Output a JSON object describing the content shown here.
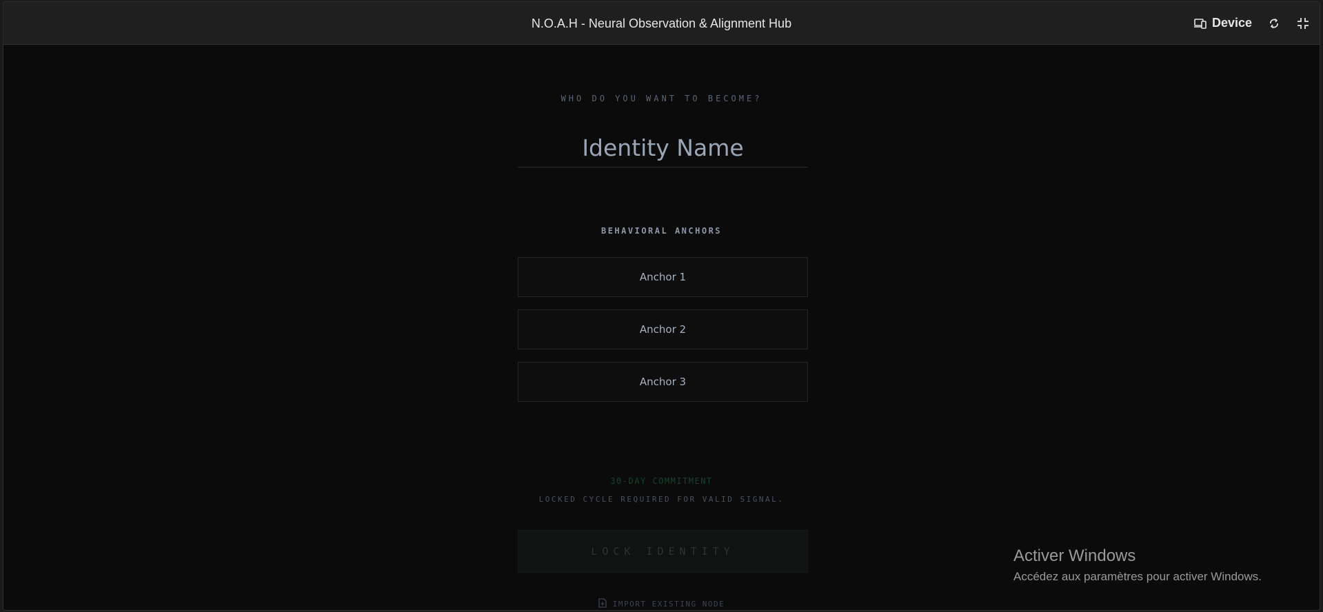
{
  "window": {
    "title": "N.O.A.H - Neural Observation & Alignment Hub",
    "device_label": "Device",
    "icons": [
      "device-icon",
      "sync-icon",
      "fullscreen-exit-icon"
    ]
  },
  "form": {
    "prompt": "WHO DO YOU WANT TO BECOME?",
    "identity_placeholder": "Identity Name",
    "identity_value": "",
    "anchors_heading": "BEHAVIORAL ANCHORS",
    "anchors": [
      {
        "placeholder": "Anchor 1"
      },
      {
        "placeholder": "Anchor 2"
      },
      {
        "placeholder": "Anchor 3"
      }
    ],
    "commitment_label": "30-DAY COMMITMENT",
    "commitment_sub": "LOCKED CYCLE REQUIRED FOR VALID SIGNAL.",
    "lock_button": "LOCK IDENTITY",
    "import_link": "IMPORT EXISTING NODE"
  },
  "watermark": {
    "title": "Activer Windows",
    "subtitle": "Accédez aux paramètres pour activer Windows."
  },
  "colors": {
    "background": "#0b0b0b",
    "titlebar": "#1f1f1f",
    "accent_green": "#17432c"
  }
}
